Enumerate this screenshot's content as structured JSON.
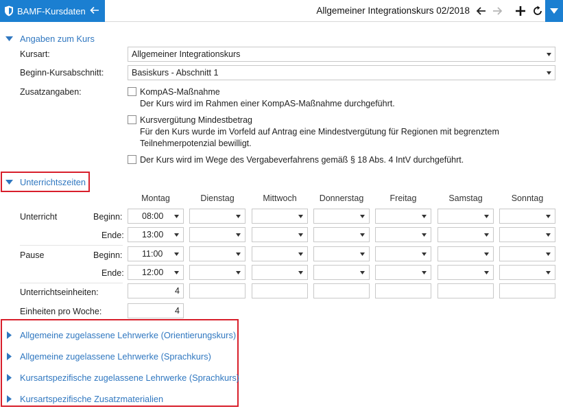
{
  "app": {
    "title": "BAMF-Kursdaten",
    "document_title": "Allgemeiner Integrationskurs 02/2018"
  },
  "section_course": {
    "title": "Angaben zum Kurs",
    "kursart_label": "Kursart:",
    "kursart_value": "Allgemeiner Integrationskurs",
    "beginn_label": "Beginn-Kursabschnitt:",
    "beginn_value": "Basiskurs - Abschnitt 1",
    "zusatz_label": "Zusatzangaben:",
    "options": [
      {
        "line1": "KompAS-Maßnahme",
        "line2": "Der Kurs wird im Rahmen einer KompAS-Maßnahme durchgeführt.",
        "checked": false
      },
      {
        "line1": "Kursvergütung Mindestbetrag",
        "line2": "Für den Kurs wurde im Vorfeld auf Antrag eine Mindestvergütung für Regionen mit begrenztem",
        "line3": "Teilnehmerpotenzial bewilligt.",
        "checked": false
      },
      {
        "line1": "Der Kurs wird im Wege des Vergabeverfahrens gemäß § 18 Abs. 4 IntV durchgeführt.",
        "checked": false
      }
    ]
  },
  "section_times": {
    "title": "Unterrichtszeiten",
    "days": [
      "Montag",
      "Dienstag",
      "Mittwoch",
      "Donnerstag",
      "Freitag",
      "Samstag",
      "Sonntag"
    ],
    "unterricht_label": "Unterricht",
    "pause_label": "Pause",
    "beginn_label": "Beginn:",
    "ende_label": "Ende:",
    "unterricht_beginn": [
      "08:00",
      "",
      "",
      "",
      "",
      "",
      ""
    ],
    "unterricht_ende": [
      "13:00",
      "",
      "",
      "",
      "",
      "",
      ""
    ],
    "pause_beginn": [
      "11:00",
      "",
      "",
      "",
      "",
      "",
      ""
    ],
    "pause_ende": [
      "12:00",
      "",
      "",
      "",
      "",
      "",
      ""
    ],
    "einheiten_label": "Unterrichtseinheiten:",
    "einheiten_values": [
      "4",
      "",
      "",
      "",
      "",
      "",
      ""
    ],
    "woche_label": "Einheiten pro Woche:",
    "woche_value": "4"
  },
  "collapsed_sections": [
    "Allgemeine zugelassene Lehrwerke (Orientierungskurs)",
    "Allgemeine zugelassene Lehrwerke (Sprachkurs)",
    "Kursartspezifische zugelassene Lehrwerke (Sprachkurs)",
    "Kursartspezifische Zusatzmaterialien"
  ],
  "colors": {
    "accent": "#1b7fd1",
    "link": "#2f77c0",
    "highlight": "#d81e2a"
  },
  "icons": [
    "shield-icon",
    "back-arrow-icon",
    "prev-arrow-icon",
    "next-arrow-icon",
    "plus-icon",
    "refresh-icon",
    "dropdown-icon",
    "chevron-down-icon",
    "triangle-right-icon"
  ]
}
